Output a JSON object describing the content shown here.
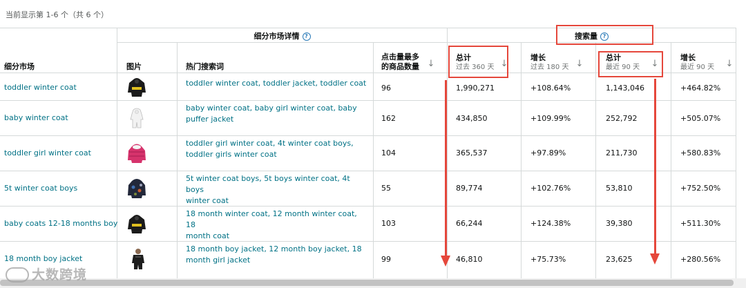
{
  "summary": "当前显示第 1-6 个（共 6 个）",
  "groups": {
    "detail": "细分市场详情",
    "volume": "搜索量"
  },
  "columns": {
    "segment": "细分市场",
    "image": "图片",
    "hot_terms": "热门搜索词",
    "top_clicks": "点击量最多的商品数量",
    "total_360": {
      "label": "总计",
      "sub": "过去 360 天"
    },
    "growth_180": {
      "label": "增长",
      "sub": "过去 180 天"
    },
    "total_90": {
      "label": "总计",
      "sub": "最近 90 天"
    },
    "growth_90": {
      "label": "增长",
      "sub": "最近 90 天"
    }
  },
  "rows": [
    {
      "segment": "toddler winter coat",
      "thumb": "black-hooded-coat",
      "terms": [
        "toddler winter coat, toddler jacket, toddler coat"
      ],
      "clicks": "96",
      "total360": "1,990,271",
      "growth180": "+108.64%",
      "total90": "1,143,046",
      "growth90": "+464.82%"
    },
    {
      "segment": "baby winter coat",
      "thumb": "white-snowsuit",
      "terms": [
        "baby winter coat, baby girl winter coat, baby",
        "puffer jacket"
      ],
      "clicks": "162",
      "total360": "434,850",
      "growth180": "+109.99%",
      "total90": "252,792",
      "growth90": "+505.07%"
    },
    {
      "segment": "toddler girl winter coat",
      "thumb": "pink-puffer",
      "terms": [
        "toddler girl winter coat, 4t winter coat boys,",
        "toddler girls winter coat"
      ],
      "clicks": "104",
      "total360": "365,537",
      "growth180": "+97.89%",
      "total90": "211,730",
      "growth90": "+580.83%"
    },
    {
      "segment": "5t winter coat boys",
      "thumb": "camo-jacket",
      "terms": [
        "5t winter coat boys, 5t boys winter coat, 4t boys",
        "winter coat"
      ],
      "clicks": "55",
      "total360": "89,774",
      "growth180": "+102.76%",
      "total90": "53,810",
      "growth90": "+752.50%"
    },
    {
      "segment": "baby coats 12-18 months boy",
      "thumb": "black-hooded-coat",
      "terms": [
        "18 month winter coat, 12 month winter coat, 18",
        "month coat"
      ],
      "clicks": "103",
      "total360": "66,244",
      "growth180": "+124.38%",
      "total90": "39,380",
      "growth90": "+511.30%"
    },
    {
      "segment": "18 month boy jacket",
      "thumb": "boy-in-jacket",
      "terms": [
        "18 month boy jacket, 12 month boy jacket, 18",
        "month girl jacket"
      ],
      "clicks": "99",
      "total360": "46,810",
      "growth180": "+75.73%",
      "total90": "23,625",
      "growth90": "+280.56%"
    }
  ],
  "watermark": "大数跨境",
  "colors": {
    "link": "#007185",
    "highlight": "#e5473b",
    "border": "#d5d9d9"
  }
}
